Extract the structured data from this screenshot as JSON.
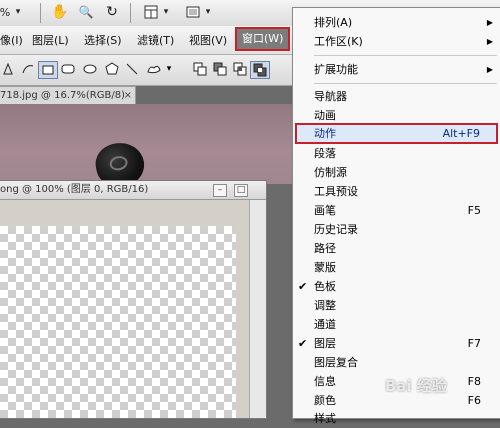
{
  "toolbar": {
    "zoom_partial": "%",
    "zoom_arrow": "▾",
    "hand": "✋",
    "zoom": "🔍",
    "rotate": "↻"
  },
  "menubar": {
    "items": [
      "像(I)",
      "图层(L)",
      "选择(S)",
      "滤镜(T)",
      "视图(V)",
      "窗口(W)"
    ]
  },
  "doc1": {
    "tab_label": "718.jpg @ 16.7%(RGB/8)",
    "close": "×"
  },
  "doc2": {
    "title": "ong @ 100% (图层 0, RGB/16)",
    "minimize": "–",
    "maximize": "□"
  },
  "window_menu": {
    "items": [
      {
        "label": "排列(A)",
        "submenu": true
      },
      {
        "label": "工作区(K)",
        "submenu": true
      },
      {
        "label": "扩展功能",
        "submenu": true
      },
      {
        "label": "导航器"
      },
      {
        "label": "动画"
      },
      {
        "label": "动作",
        "shortcut": "Alt+F9",
        "highlighted": true
      },
      {
        "label": "段落"
      },
      {
        "label": "仿制源"
      },
      {
        "label": "工具预设"
      },
      {
        "label": "画笔",
        "shortcut": "F5"
      },
      {
        "label": "历史记录"
      },
      {
        "label": "路径"
      },
      {
        "label": "蒙版"
      },
      {
        "label": "色板",
        "checked": true
      },
      {
        "label": "调整"
      },
      {
        "label": "通道"
      },
      {
        "label": "图层",
        "shortcut": "F7",
        "checked": true
      },
      {
        "label": "图层复合"
      },
      {
        "label": "信息",
        "shortcut": "F8"
      },
      {
        "label": "颜色",
        "shortcut": "F6"
      },
      {
        "label": "样式"
      }
    ]
  },
  "watermark": "Bai 经验"
}
